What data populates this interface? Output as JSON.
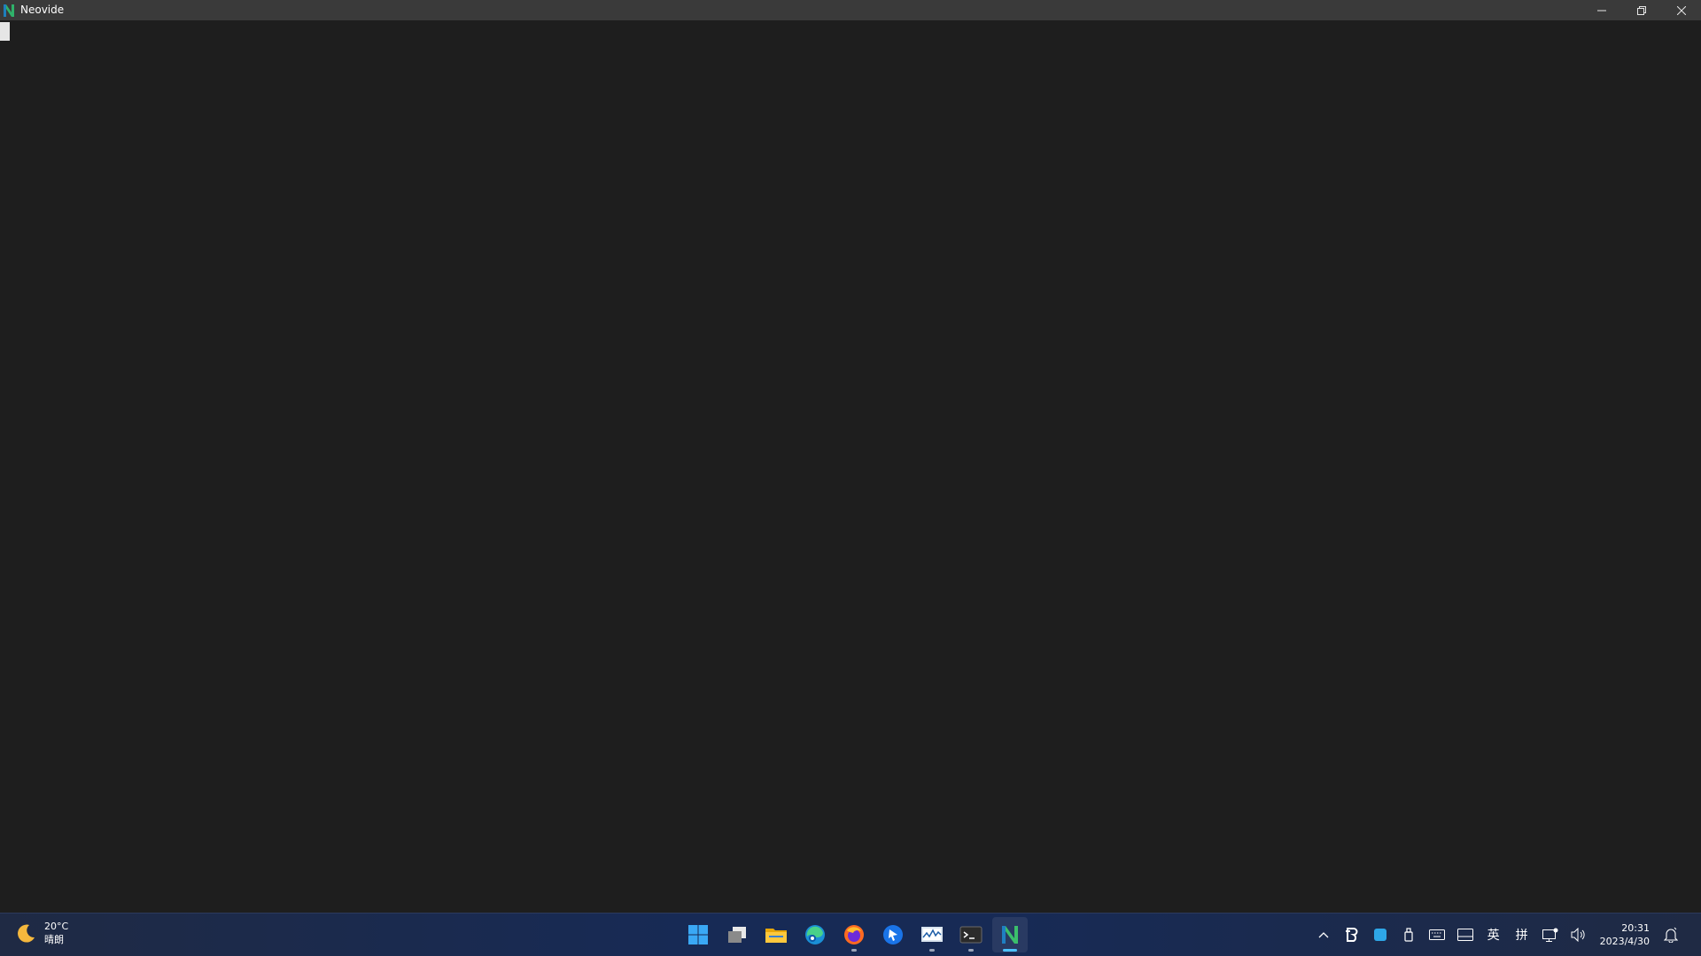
{
  "window": {
    "title": "Neovide",
    "controls": {
      "minimize_icon": "minimize-icon",
      "restore_icon": "restore-icon",
      "close_icon": "close-icon"
    }
  },
  "editor": {
    "background": "#1e1e1e",
    "cursor_color": "#e6e6e6"
  },
  "taskbar": {
    "weather": {
      "temperature": "20°C",
      "condition": "晴朗",
      "icon": "moon-icon"
    },
    "apps": [
      {
        "name": "start",
        "icon": "windows-start-icon",
        "running": false,
        "active": false
      },
      {
        "name": "task-view",
        "icon": "task-view-icon",
        "running": false,
        "active": false
      },
      {
        "name": "file-explorer",
        "icon": "folder-icon",
        "running": false,
        "active": false
      },
      {
        "name": "edge",
        "icon": "edge-icon",
        "running": false,
        "active": false
      },
      {
        "name": "firefox",
        "icon": "firefox-icon",
        "running": true,
        "active": false
      },
      {
        "name": "blue-arrow-app",
        "icon": "blue-arrow-icon",
        "running": false,
        "active": false
      },
      {
        "name": "resource-monitor",
        "icon": "performance-monitor-icon",
        "running": true,
        "active": false
      },
      {
        "name": "terminal",
        "icon": "terminal-icon",
        "running": true,
        "active": false
      },
      {
        "name": "neovide",
        "icon": "neovide-icon",
        "running": true,
        "active": true
      }
    ],
    "tray": {
      "ime_lang": "英",
      "ime_mode": "拼",
      "time": "20:31",
      "date": "2023/4/30"
    },
    "accent": "#4cc2ff"
  }
}
